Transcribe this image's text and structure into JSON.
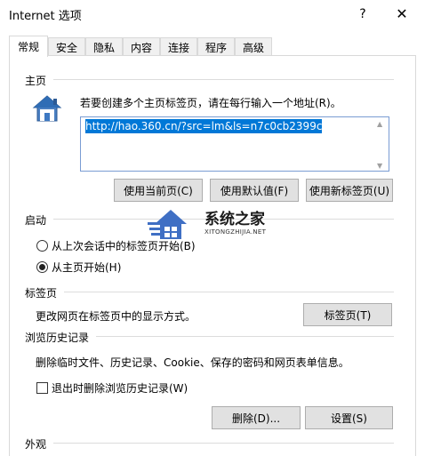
{
  "window": {
    "title": "Internet 选项",
    "help_glyph": "?",
    "close_glyph": "✕"
  },
  "tabs": [
    {
      "label": "常规",
      "active": true
    },
    {
      "label": "安全"
    },
    {
      "label": "隐私"
    },
    {
      "label": "内容"
    },
    {
      "label": "连接"
    },
    {
      "label": "程序"
    },
    {
      "label": "高级"
    }
  ],
  "home": {
    "heading": "主页",
    "description": "若要创建多个主页标签页，请在每行输入一个地址(R)。",
    "url_value": "http://hao.360.cn/?src=lm&ls=n7c0cb2399c",
    "buttons": {
      "use_current": "使用当前页(C)",
      "use_default": "使用默认值(F)",
      "use_new_tab": "使用新标签页(U)"
    }
  },
  "startup": {
    "heading": "启动",
    "option_last_session": "从上次会话中的标签页开始(B)",
    "option_home": "从主页开始(H)",
    "selected": "option_home"
  },
  "tabs_section": {
    "heading": "标签页",
    "description": "更改网页在标签页中的显示方式。",
    "button": "标签页(T)"
  },
  "history": {
    "heading": "浏览历史记录",
    "description": "删除临时文件、历史记录、Cookie、保存的密码和网页表单信息。",
    "checkbox_label": "退出时删除浏览历史记录(W)",
    "checkbox_checked": false,
    "delete_button": "删除(D)...",
    "settings_button": "设置(S)"
  },
  "appearance": {
    "heading": "外观"
  },
  "watermark": {
    "title": "系统之家",
    "subtitle": "XITONGZHIJIA.NET"
  },
  "colors": {
    "accent": "#0078d7",
    "button_bg": "#e1e1e1",
    "border": "#adadad"
  }
}
